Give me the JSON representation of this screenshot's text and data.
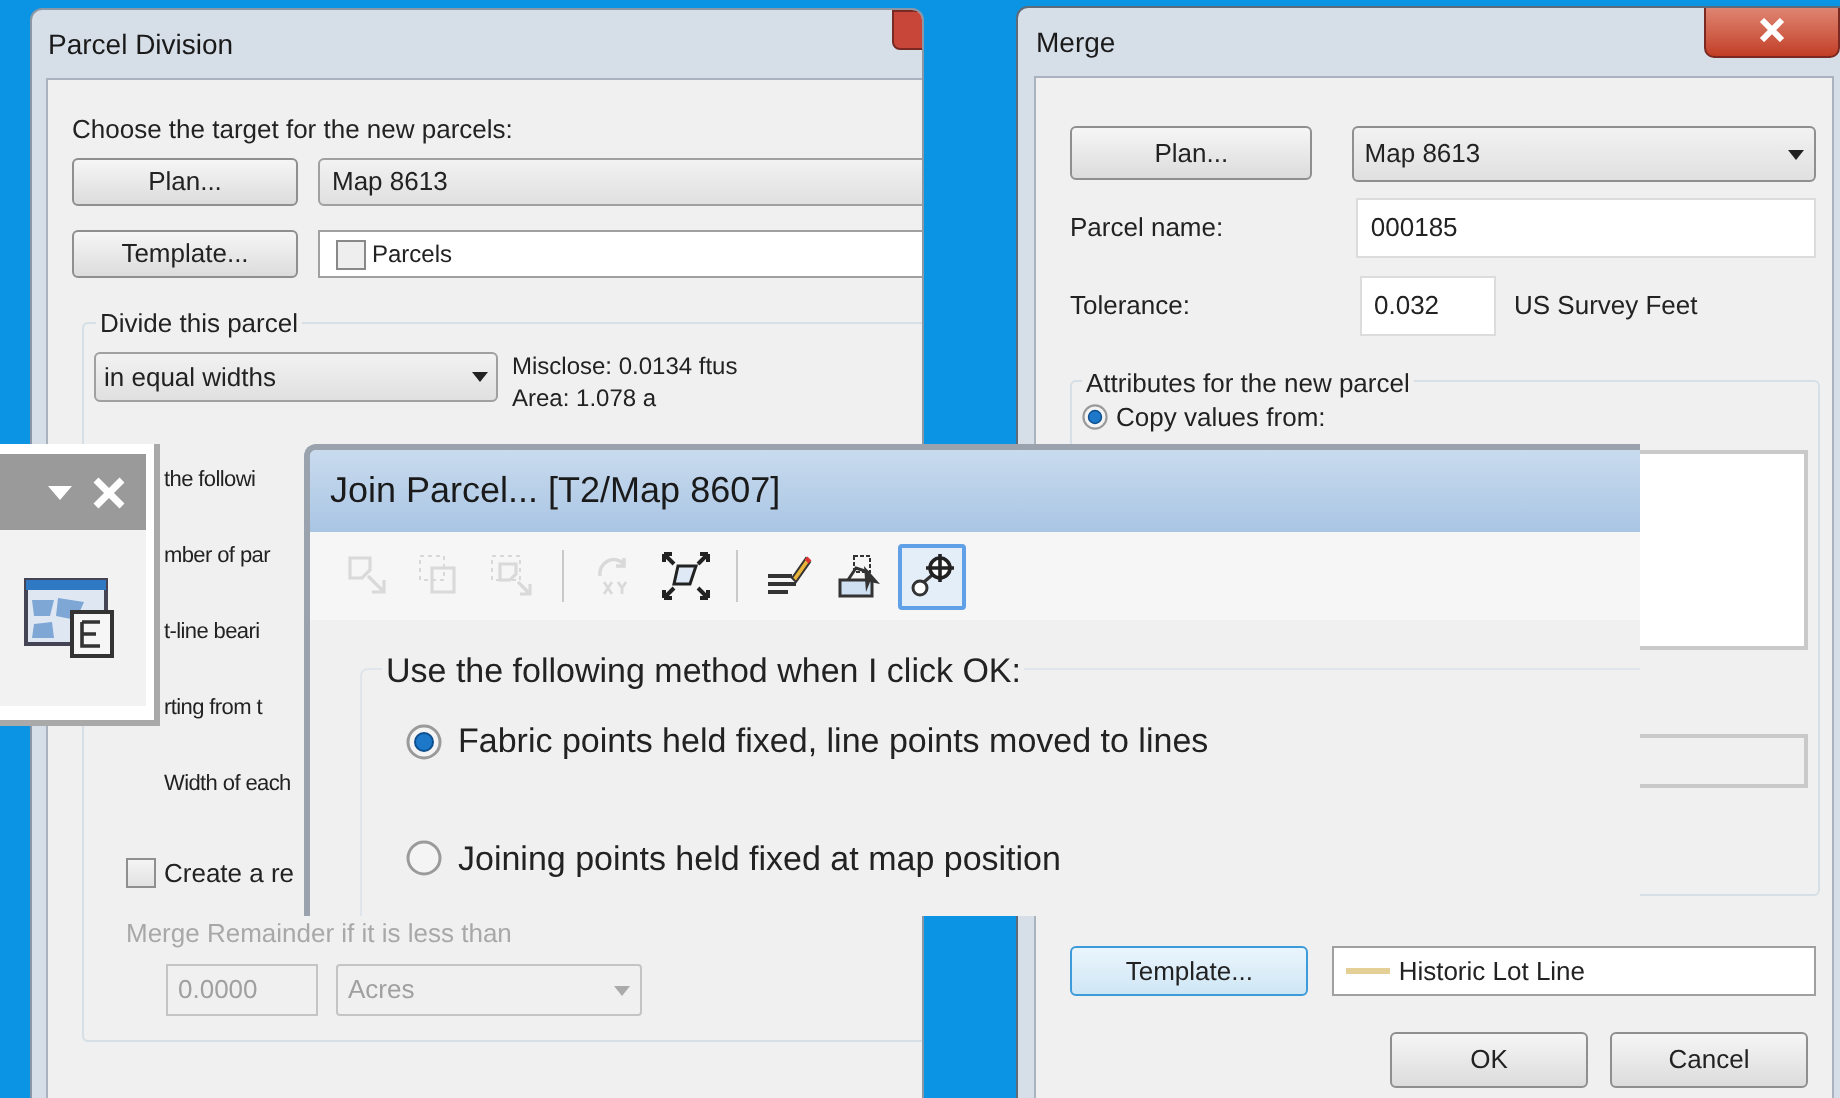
{
  "parcel_division": {
    "title": "Parcel Division",
    "prompt": "Choose the target for the new parcels:",
    "plan_button": "Plan...",
    "plan_value": "Map 8613",
    "template_button": "Template...",
    "template_value": "Parcels",
    "group_label": "Divide this parcel",
    "divide_method": "in equal widths",
    "misclose": "Misclose: 0.0134 ftus",
    "area": "Area: 1.078 a",
    "labels": [
      "the followi",
      "mber of par",
      "t-line beari",
      "rting from t",
      "Width of each"
    ],
    "remainder_checkbox": {
      "label": "Create a re",
      "checked": false
    },
    "remainder": {
      "label": "Merge Remainder if it is less than",
      "value": "0.0000",
      "unit": "Acres",
      "disabled": true
    }
  },
  "merge": {
    "title": "Merge",
    "plan_button": "Plan...",
    "plan_value": "Map 8613",
    "parcel_name_label": "Parcel name:",
    "parcel_name": "000185",
    "tolerance_label": "Tolerance:",
    "tolerance": "0.032",
    "tolerance_unit": "US Survey Feet",
    "group_label": "Attributes for the new parcel",
    "copy_option": {
      "label": "Copy values from:",
      "selected": true
    },
    "template_button": "Template...",
    "template_value": "Historic Lot Line",
    "buttons": [
      "OK",
      "Cancel"
    ]
  },
  "join_parcel": {
    "title": "Join Parcel... [T2/Map 8607]",
    "toolbar": [
      {
        "kind": "tool",
        "disabled": true,
        "selected": false
      },
      {
        "kind": "tool",
        "disabled": true,
        "selected": false
      },
      {
        "kind": "tool",
        "disabled": true,
        "selected": false
      },
      {
        "kind": "separator"
      },
      {
        "kind": "tool",
        "disabled": true,
        "selected": false
      },
      {
        "kind": "tool",
        "disabled": false,
        "selected": false
      },
      {
        "kind": "separator"
      },
      {
        "kind": "tool",
        "disabled": false,
        "selected": false
      },
      {
        "kind": "tool",
        "disabled": false,
        "selected": false
      },
      {
        "kind": "tool",
        "disabled": false,
        "selected": true
      }
    ],
    "group_label": "Use the following method when I click OK:",
    "options": [
      {
        "label": "Fabric points held fixed, line points moved to lines",
        "selected": true
      },
      {
        "label": "Joining points held fixed at map position",
        "selected": false
      }
    ]
  }
}
